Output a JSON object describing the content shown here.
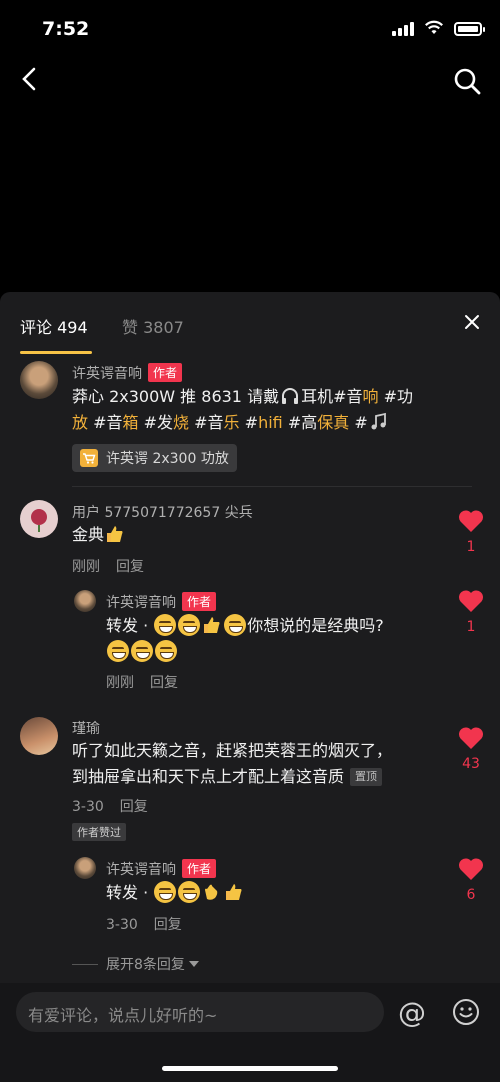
{
  "status": {
    "time": "7:52"
  },
  "colors": {
    "accent": "#f7c347",
    "like": "#f2354e",
    "panel": "#1c1c1e",
    "highlight": "#f2b13a"
  },
  "icons": [
    "back-chevron-icon",
    "search-icon",
    "close-icon",
    "heart-icon",
    "cart-icon",
    "at-icon",
    "smile-icon",
    "signal-icon",
    "wifi-icon",
    "battery-icon"
  ],
  "tabs": {
    "comments": "评论 494",
    "likes": "赞 3807"
  },
  "comments": [
    {
      "user": "许英谔音响",
      "badge": "作者",
      "text_parts": [
        "莽心 2x300W 推 8631 请戴",
        "耳机#音",
        "响",
        " #功",
        "放",
        " #音",
        "箱",
        " #发",
        "烧",
        " #音",
        "乐",
        " #",
        "hifi",
        " #高",
        "保真",
        " #"
      ],
      "product": "许英谔 2x300 功放"
    },
    {
      "user": "用户 5775071772657 尖兵",
      "text": "金典",
      "time": "刚刚",
      "reply": "回复",
      "likes": "1",
      "subreply": {
        "user": "许英谔音响",
        "badge": "作者",
        "text_a": "转发 · ",
        "text_b": "你想说的是经典吗?",
        "time": "刚刚",
        "reply": "回复",
        "likes": "1"
      }
    },
    {
      "user": "瑾瑜",
      "text_line1": "听了如此天籁之音，赶紧把芙蓉王的烟灭了，",
      "text_line2": "到抽屉拿出和天下点上才配上着这音质",
      "pin": "置顶",
      "time": "3-30",
      "reply": "回复",
      "tag": "作者赞过",
      "likes": "43",
      "subreply": {
        "user": "许英谔音响",
        "badge": "作者",
        "text_a": "转发 · ",
        "time": "3-30",
        "reply": "回复",
        "likes": "6"
      },
      "expand": "展开8条回复"
    }
  ],
  "input": {
    "placeholder": "有爱评论，说点儿好听的~",
    "at": "@"
  }
}
